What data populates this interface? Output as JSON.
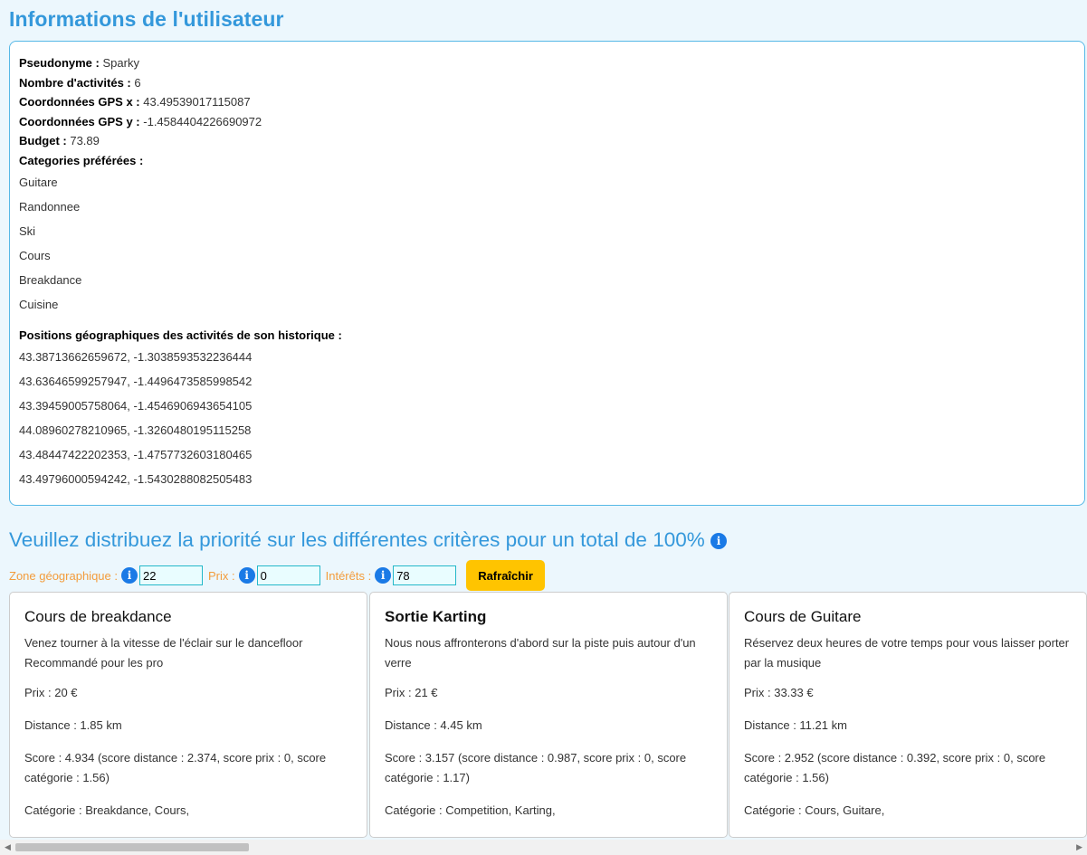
{
  "user": {
    "title": "Informations de l'utilisateur",
    "fields": [
      {
        "label": "Pseudonyme :",
        "value": "Sparky"
      },
      {
        "label": "Nombre d'activités :",
        "value": "6"
      },
      {
        "label": "Coordonnées GPS x :",
        "value": "43.49539017115087"
      },
      {
        "label": "Coordonnées GPS y :",
        "value": "-1.4584404226690972"
      },
      {
        "label": "Budget :",
        "value": "73.89"
      }
    ],
    "categories_label": "Categories préférées :",
    "categories": [
      "Guitare",
      "Randonnee",
      "Ski",
      "Cours",
      "Breakdance",
      "Cuisine"
    ],
    "history_label": "Positions géographiques des activités de son historique :",
    "history": [
      "43.38713662659672, -1.3038593532236444",
      "43.63646599257947, -1.4496473585998542",
      "43.39459005758064, -1.4546906943654105",
      "44.08960278210965, -1.3260480195115258",
      "43.48447422202353, -1.4757732603180465",
      "43.49796000594242, -1.5430288082505483"
    ]
  },
  "priority": {
    "title": "Veuillez distribuez la priorité sur les différentes critères pour un total de 100%",
    "zone_label": "Zone géographique :",
    "zone_value": "22",
    "prix_label": "Prix :",
    "prix_value": "0",
    "interets_label": "Intérêts :",
    "interets_value": "78",
    "refresh_label": "Rafraîchir"
  },
  "cards": [
    {
      "title": "Cours de breakdance",
      "desc": "Venez tourner à la vitesse de l'éclair sur le dancefloor Recommandé pour les pro",
      "prix": "Prix : 20 €",
      "distance": "Distance : 1.85 km",
      "score": "Score : 4.934 (score distance : 2.374, score prix : 0, score catégorie : 1.56)",
      "categorie": "Catégorie : Breakdance, Cours,"
    },
    {
      "title": "Sortie Karting",
      "desc": "Nous nous affronterons d'abord sur la piste puis autour d'un verre",
      "prix": "Prix : 21 €",
      "distance": "Distance : 4.45 km",
      "score": "Score : 3.157 (score distance : 0.987, score prix : 0, score catégorie : 1.17)",
      "categorie": "Catégorie : Competition, Karting,"
    },
    {
      "title": "Cours de Guitare",
      "desc": "Réservez deux heures de votre temps pour vous laisser porter par la musique",
      "prix": "Prix : 33.33 €",
      "distance": "Distance : 11.21 km",
      "score": "Score : 2.952 (score distance : 0.392, score prix : 0, score catégorie : 1.56)",
      "categorie": "Catégorie : Cours, Guitare,"
    }
  ],
  "icons": {
    "info": "info-icon",
    "scroll_left": "arrow-left-icon",
    "scroll_right": "arrow-right-icon"
  },
  "colors": {
    "accent": "#3498db",
    "label_orange": "#f39c3c",
    "button_yellow": "#ffc400",
    "info_blue": "#1a7ae6"
  }
}
